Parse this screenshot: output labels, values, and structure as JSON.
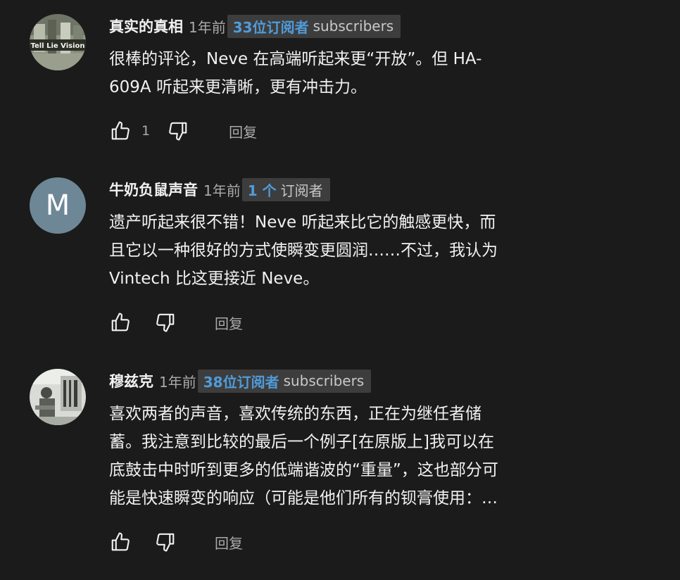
{
  "colors": {
    "background": "#1b1b1b",
    "text_primary": "#f1f1f1",
    "text_secondary": "#aaaaaa",
    "badge_bg": "#3d3d3d",
    "badge_count": "#4f9cdb",
    "avatar_letter_bg": "#6e8796"
  },
  "comments": [
    {
      "author": "真实的真相",
      "time": "1年前",
      "badge_count": "33位订阅者",
      "badge_suffix": "subscribers",
      "avatar_text": "Tell Lie Vision",
      "body_lines": [
        "很棒的评论，Neve 在高端听起来更“开放”。但 HA-",
        "609A 听起来更清晰，更有冲击力。"
      ],
      "likes": "1",
      "reply_label": "回复",
      "icons": [
        "thumbs-up-icon",
        "thumbs-down-icon"
      ]
    },
    {
      "author": "牛奶负鼠声音",
      "time": "1年前",
      "badge_count": "1 个",
      "badge_suffix": "订阅者",
      "avatar_letter": "M",
      "body_lines": [
        "遗产听起来很不错！Neve 听起来比它的触感更快，而",
        "且它以一种很好的方式使瞬变更圆润……不过，我认为",
        "Vintech 比这更接近 Neve。"
      ],
      "likes": "",
      "reply_label": "回复",
      "icons": [
        "thumbs-up-icon",
        "thumbs-down-icon"
      ]
    },
    {
      "author": "穆兹克",
      "time": "1年前",
      "badge_count": "38位订阅者",
      "badge_suffix": "subscribers",
      "body_lines": [
        "喜欢两者的声音，喜欢传统的东西，正在为继任者储",
        "蓄。我注意到比较的最后一个例子[在原版上]我可以在",
        "底鼓击中时听到更多的低端谐波的“重量”，这也部分可",
        "能是快速瞬变的响应（可能是他们所有的钡膏使用：…"
      ],
      "likes": "",
      "reply_label": "回复",
      "icons": [
        "thumbs-up-icon",
        "thumbs-down-icon"
      ]
    }
  ]
}
